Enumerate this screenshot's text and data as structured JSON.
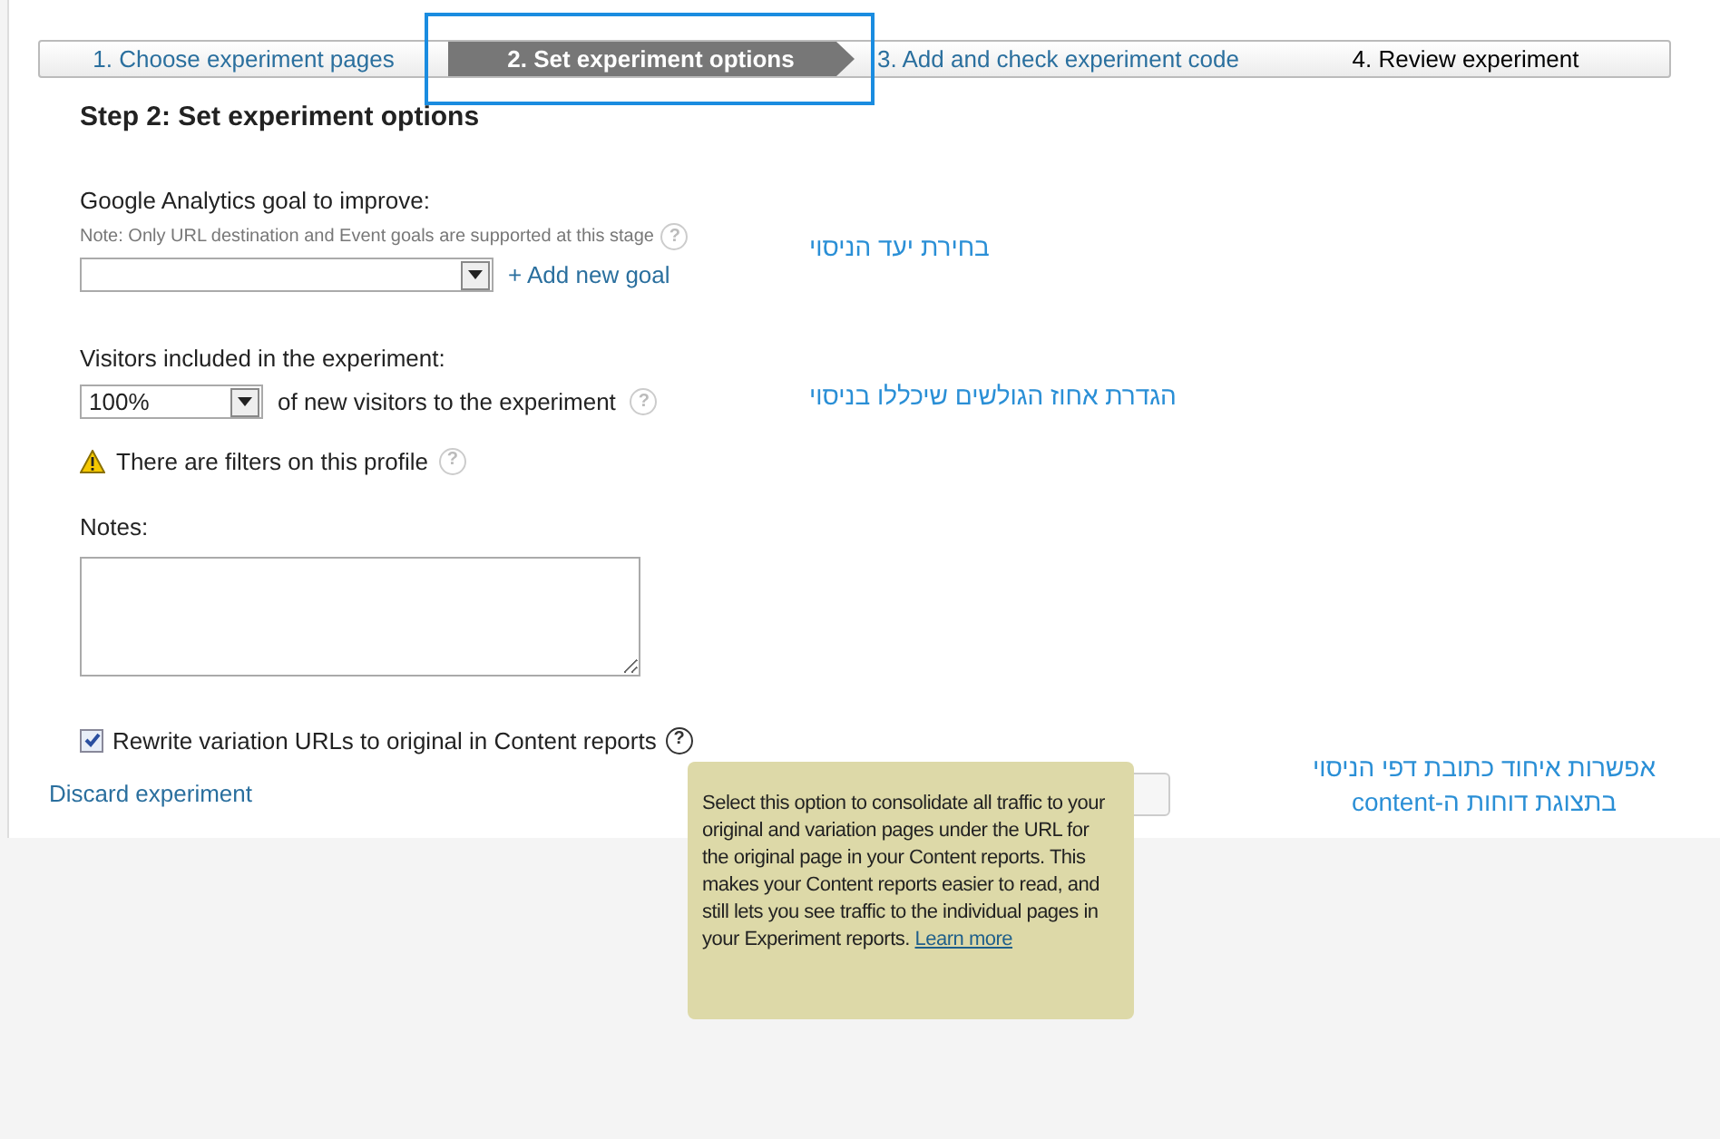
{
  "steps": [
    {
      "label": "1. Choose experiment pages",
      "selected": false
    },
    {
      "label": "2. Set experiment options",
      "selected": true
    },
    {
      "label": "3. Add and check experiment code",
      "selected": false
    },
    {
      "label": "4. Review experiment",
      "selected": false
    }
  ],
  "heading": "Step 2: Set experiment options",
  "goal": {
    "label": "Google Analytics goal to improve:",
    "note": "Note: Only URL destination and Event goals are supported at this stage",
    "add_link": "+ Add new goal",
    "help": "?"
  },
  "visitors": {
    "label": "Visitors included in the experiment:",
    "value": "100%",
    "suffix": "of new visitors to the experiment",
    "help": "?"
  },
  "warning": {
    "text": "There are filters on this profile",
    "help": "?"
  },
  "notes": {
    "label": "Notes:"
  },
  "rewrite": {
    "label": "Rewrite variation URLs to original in Content reports",
    "checked": true,
    "help": "?"
  },
  "discard_link": "Discard experiment",
  "tooltip": {
    "text": "Select this option to consolidate all traffic to your original and variation pages under the URL for the original page in your Content reports. This makes your Content reports easier to read, and still lets you see traffic to the individual pages in your Experiment reports.",
    "link": "Learn more"
  },
  "annotations": [
    "בחירת יעד הניסוי",
    "הגדרת אחוז הגולשים שיכללו בניסוי",
    "אפשרות איחוד כתובת דפי הניסוי בתצוגת דוחות ה-content"
  ]
}
